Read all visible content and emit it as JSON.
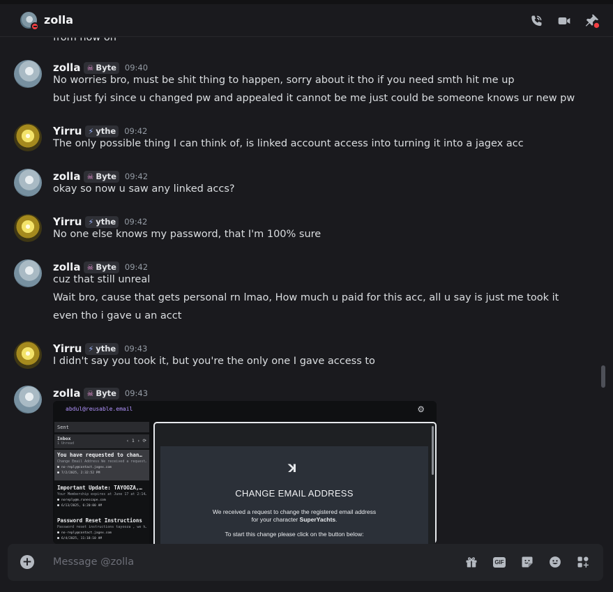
{
  "header": {
    "title": "zolla",
    "icons": [
      "phone-call-icon",
      "video-call-icon",
      "pin-icon"
    ]
  },
  "cut_text": "from now on",
  "messages": [
    {
      "author": "zolla",
      "tag": "Byte",
      "time": "09:40",
      "lines": [
        "No worries bro, must be shit thing to happen, sorry about it tho if you need smth hit me up",
        "but just fyi since u changed pw and appealed it cannot be me just could be someone knows ur new pw"
      ]
    },
    {
      "author": "Yirru",
      "tag": "ythe",
      "time": "09:42",
      "lines": [
        "The only possible thing I can think of, is linked account access into turning it into a jagex acc"
      ]
    },
    {
      "author": "zolla",
      "tag": "Byte",
      "time": "09:42",
      "lines": [
        "okay so now u saw any linked accs?"
      ]
    },
    {
      "author": "Yirru",
      "tag": "ythe",
      "time": "09:42",
      "lines": [
        "No one else knows my password, that I'm 100% sure"
      ]
    },
    {
      "author": "zolla",
      "tag": "Byte",
      "time": "09:42",
      "lines": [
        "cuz that still unreal",
        "Wait bro, cause that gets personal rn lmao, How much u paid for this acc, all u say is just me took it",
        "even tho i gave u an acct"
      ]
    },
    {
      "author": "Yirru",
      "tag": "ythe",
      "time": "09:43",
      "lines": [
        "I didn't say you took it, but you're the only one I gave access to"
      ]
    },
    {
      "author": "zolla",
      "tag": "Byte",
      "time": "09:43",
      "lines": []
    }
  ],
  "attachment": {
    "email": "abdul@reusable.email",
    "sent_label": "Sent",
    "inbox_label": "Inbox",
    "inbox_unread": "1 Unread",
    "pager": "‹ 1 ›",
    "items": [
      {
        "subject": "You have requested to chan…",
        "preview": "Change Email Address We received a request…",
        "from": "no-reply@contact.jagex.com",
        "date": "7/2/2025, 2:32:52 PM"
      },
      {
        "subject": "Important Update: TAYOOZA,…",
        "preview": "Your Membership expires at June 17 at 2:14…",
        "from": "noreply@m.runescape.com",
        "date": "6/13/2025, 6:20:00 AM"
      },
      {
        "subject": "Password Reset Instructions",
        "preview": "Password reset instructions tayooza , we h…",
        "from": "no-reply@contact.jagex.com",
        "date": "6/4/2025, 11:18:10 AM"
      }
    ],
    "logo": "ꓘ",
    "heading": "CHANGE EMAIL ADDRESS",
    "para1": "We received a request to change the registered email address",
    "para2_prefix": "for your character ",
    "para2_name": "SuperYachts",
    "para2_suffix": ".",
    "para3": "To start this change please click on the button below:"
  },
  "composer": {
    "placeholder": "Message @zolla",
    "gif_label": "GIF",
    "icons": [
      "gift-icon",
      "gif-icon",
      "sticker-icon",
      "emoji-icon",
      "apps-icon"
    ]
  },
  "colors": {
    "background": "#1a1a1e",
    "status_dnd": "#f23f43",
    "email_purple": "#b294ff"
  }
}
